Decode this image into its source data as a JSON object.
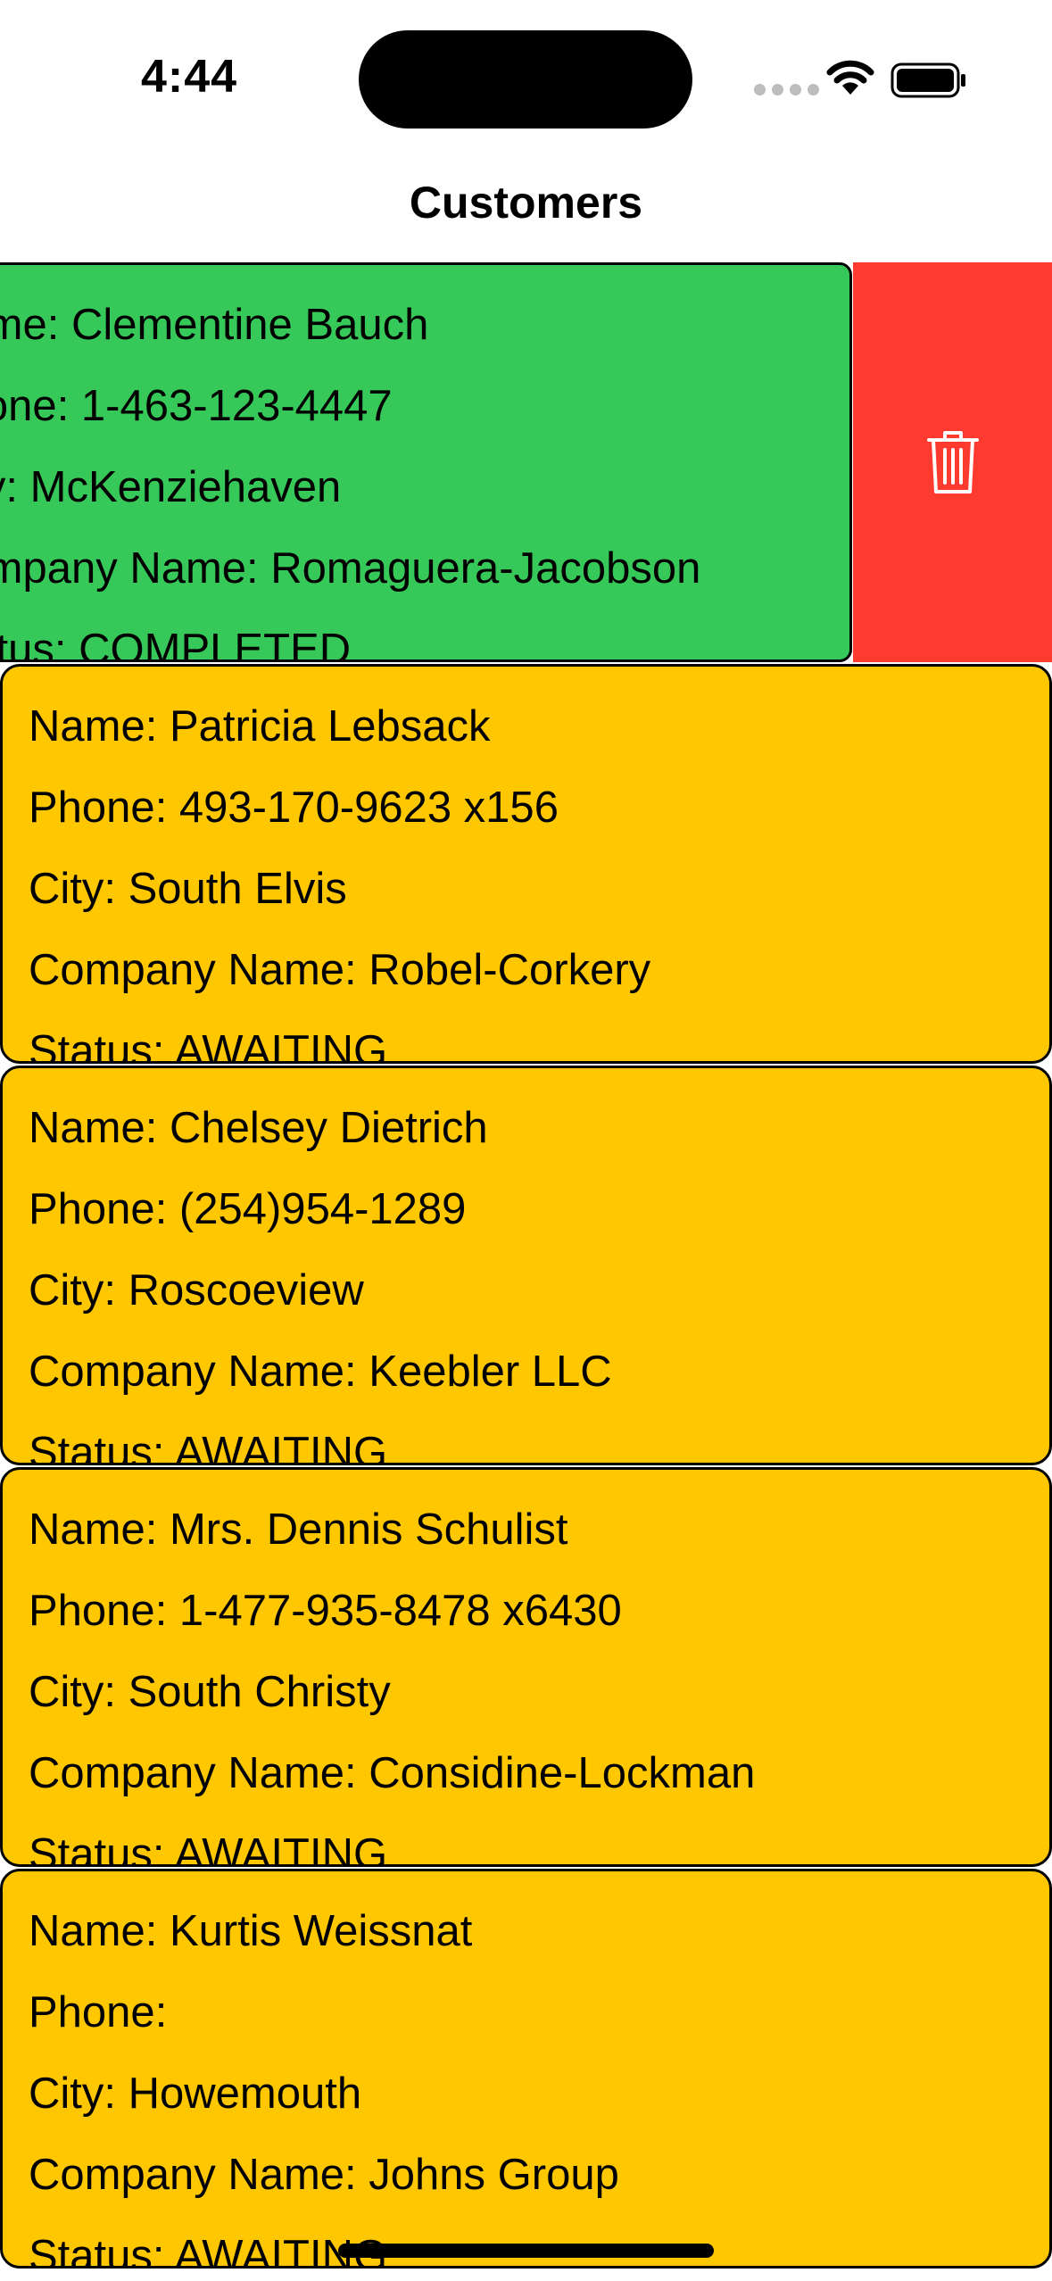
{
  "status_bar": {
    "time": "4:44"
  },
  "nav": {
    "title": "Customers"
  },
  "labels": {
    "name": "Name: ",
    "phone": "Phone: ",
    "city": "City: ",
    "company": "Company Name: ",
    "status": "Status: "
  },
  "swiped_card": {
    "name": "Clementine Bauch",
    "phone": "1-463-123-4447",
    "city": "McKenziehaven",
    "company": "Romaguera-Jacobson",
    "status": "COMPLETED",
    "color": "#36c95a"
  },
  "delete_action": {
    "icon": "trash-icon",
    "color": "#ff3b30"
  },
  "customers": [
    {
      "name": "Patricia Lebsack",
      "phone": "493-170-9623 x156",
      "city": "South Elvis",
      "company": "Robel-Corkery",
      "status": "AWAITING"
    },
    {
      "name": "Chelsey Dietrich",
      "phone": "(254)954-1289",
      "city": "Roscoeview",
      "company": "Keebler LLC",
      "status": "AWAITING"
    },
    {
      "name": "Mrs. Dennis Schulist",
      "phone": "1-477-935-8478 x6430",
      "city": "South Christy",
      "company": "Considine-Lockman",
      "status": "AWAITING"
    },
    {
      "name": "Kurtis Weissnat",
      "phone": "",
      "city": "Howemouth",
      "company": "Johns Group",
      "status": "AWAITING"
    }
  ],
  "colors": {
    "awaiting": "#ffc700",
    "completed": "#36c95a",
    "delete": "#ff3b30"
  }
}
